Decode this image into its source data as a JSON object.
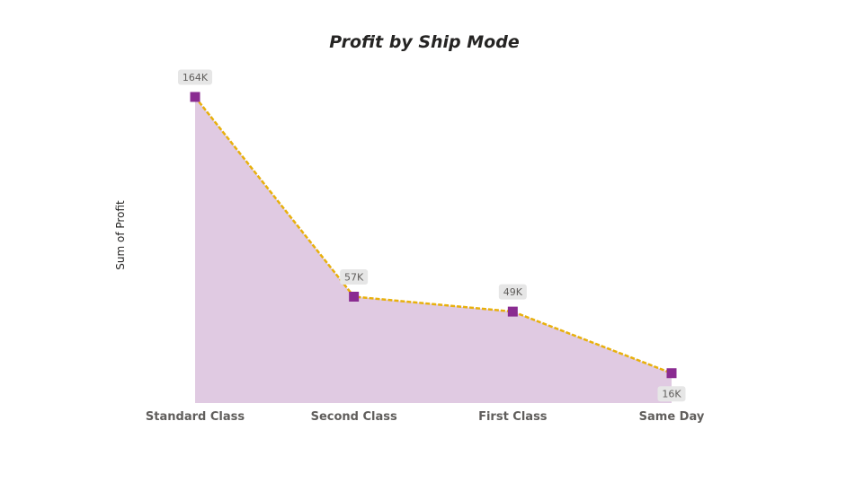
{
  "chart_data": {
    "type": "area",
    "title": "Profit by Ship Mode",
    "xlabel": "",
    "ylabel": "Sum of Profit",
    "categories": [
      "Standard Class",
      "Second Class",
      "First Class",
      "Same Day"
    ],
    "values": [
      164000,
      57000,
      49000,
      16000
    ],
    "data_labels": [
      "164K",
      "57K",
      "49K",
      "16K"
    ],
    "ylim": [
      0,
      164000
    ],
    "grid": false,
    "legend": "none",
    "colors": {
      "area_fill": "#e0cae2",
      "line": "#e8b00c",
      "marker": "#8a2b91",
      "label_bg": "#e6e6e6"
    }
  }
}
